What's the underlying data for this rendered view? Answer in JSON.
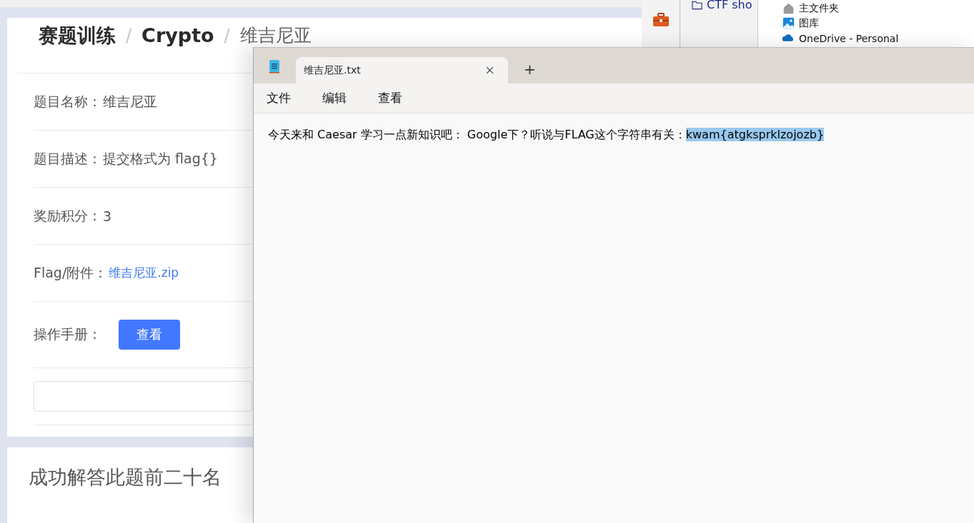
{
  "webpage": {
    "breadcrumb": [
      {
        "label": "赛题训练"
      },
      {
        "label": "Crypto"
      },
      {
        "label": "维吉尼亚"
      }
    ],
    "separator": "/",
    "fields": [
      {
        "kind": "text",
        "label": "题目名称：",
        "value": "维吉尼亚"
      },
      {
        "kind": "text",
        "label": "题目描述：",
        "value": "提交格式为 flag{}"
      },
      {
        "kind": "text",
        "label": "奖励积分：",
        "value": "3"
      },
      {
        "kind": "link",
        "label": "Flag/附件：",
        "value": "维吉尼亚.zip"
      },
      {
        "kind": "button",
        "label": "操作手册：",
        "value": "查看"
      },
      {
        "kind": "input"
      }
    ],
    "ranking_title": "成功解答此题前二十名"
  },
  "explorer": {
    "folder": "CTF sho",
    "nav_items": [
      {
        "label": "主文件夹"
      },
      {
        "label": "图库"
      },
      {
        "label": "OneDrive - Personal"
      }
    ]
  },
  "notepad": {
    "tab": {
      "title": "维吉尼亚.txt",
      "selected": true
    },
    "new_tab": "+",
    "menu": [
      "文件",
      "编辑",
      "查看"
    ],
    "text": "今天来和 Caesar 学习一点新知识吧： Google下？听说与FLAG这个字符串有关：",
    "selected_text": "kwam{atgksprklzojozb}"
  }
}
